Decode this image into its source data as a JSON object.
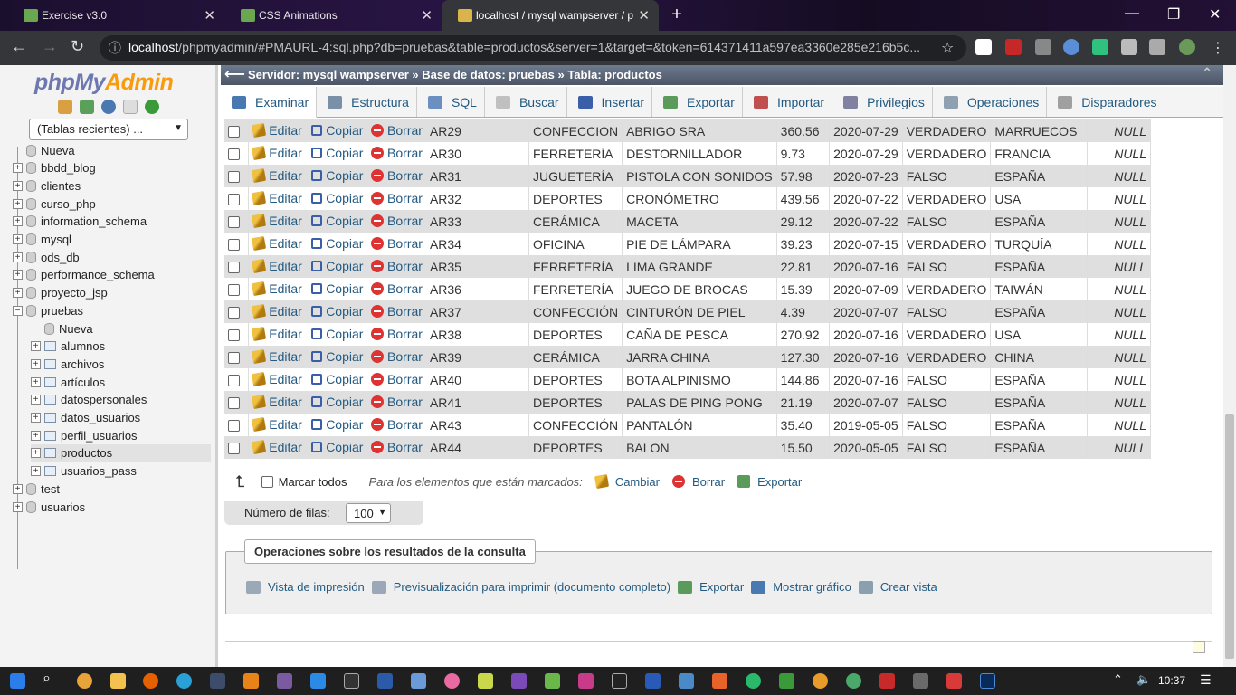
{
  "browser": {
    "tabs": [
      {
        "title": "Exercise v3.0",
        "active": false
      },
      {
        "title": "CSS Animations",
        "active": false
      },
      {
        "title": "localhost / mysql wampserver / p",
        "active": true
      }
    ],
    "url_host": "localhost",
    "url_rest": "/phpmyadmin/#PMAURL-4:sql.php?db=pruebas&table=productos&server=1&target=&token=614371411a597ea3360e285e216b5c..."
  },
  "sidebar": {
    "logo_php": "php",
    "logo_my": "My",
    "logo_admin": "Admin",
    "recent_select": "(Tablas recientes) ...",
    "tree": [
      {
        "label": "Nueva",
        "level": 0,
        "type": "new"
      },
      {
        "label": "bbdd_blog",
        "level": 0,
        "type": "db"
      },
      {
        "label": "clientes",
        "level": 0,
        "type": "db"
      },
      {
        "label": "curso_php",
        "level": 0,
        "type": "db"
      },
      {
        "label": "information_schema",
        "level": 0,
        "type": "db"
      },
      {
        "label": "mysql",
        "level": 0,
        "type": "db"
      },
      {
        "label": "ods_db",
        "level": 0,
        "type": "db"
      },
      {
        "label": "performance_schema",
        "level": 0,
        "type": "db"
      },
      {
        "label": "proyecto_jsp",
        "level": 0,
        "type": "db"
      },
      {
        "label": "pruebas",
        "level": 0,
        "type": "db-open"
      },
      {
        "label": "Nueva",
        "level": 1,
        "type": "new"
      },
      {
        "label": "alumnos",
        "level": 1,
        "type": "tbl"
      },
      {
        "label": "archivos",
        "level": 1,
        "type": "tbl"
      },
      {
        "label": "artículos",
        "level": 1,
        "type": "tbl"
      },
      {
        "label": "datospersonales",
        "level": 1,
        "type": "tbl"
      },
      {
        "label": "datos_usuarios",
        "level": 1,
        "type": "tbl"
      },
      {
        "label": "perfil_usuarios",
        "level": 1,
        "type": "tbl"
      },
      {
        "label": "productos",
        "level": 1,
        "type": "tbl",
        "selected": true
      },
      {
        "label": "usuarios_pass",
        "level": 1,
        "type": "tbl"
      },
      {
        "label": "test",
        "level": 0,
        "type": "db"
      },
      {
        "label": "usuarios",
        "level": 0,
        "type": "db"
      }
    ]
  },
  "breadcrumb": {
    "server": "Servidor: mysql wampserver »",
    "database": "Base de datos: pruebas »",
    "table": "Tabla: productos"
  },
  "tabs": [
    {
      "label": "Examinar",
      "active": true,
      "color": "#4a78b0"
    },
    {
      "label": "Estructura",
      "active": false,
      "color": "#7a8fa8"
    },
    {
      "label": "SQL",
      "active": false,
      "color": "#6a8fc0"
    },
    {
      "label": "Buscar",
      "active": false,
      "color": "#c0c0c0"
    },
    {
      "label": "Insertar",
      "active": false,
      "color": "#3a5fa8"
    },
    {
      "label": "Exportar",
      "active": false,
      "color": "#5a9a5a"
    },
    {
      "label": "Importar",
      "active": false,
      "color": "#c05050"
    },
    {
      "label": "Privilegios",
      "active": false,
      "color": "#8080a0"
    },
    {
      "label": "Operaciones",
      "active": false,
      "color": "#8fa0b0"
    },
    {
      "label": "Disparadores",
      "active": false,
      "color": "#a0a0a0"
    }
  ],
  "row_actions": {
    "edit": "Editar",
    "copy": "Copiar",
    "delete": "Borrar"
  },
  "rows": [
    [
      "AR29",
      "CONFECCION",
      "ABRIGO SRA",
      "360.56",
      "2020-07-29",
      "VERDADERO",
      "MARRUECOS",
      "NULL"
    ],
    [
      "AR30",
      "FERRETERÍA",
      "DESTORNILLADOR",
      "9.73",
      "2020-07-29",
      "VERDADERO",
      "FRANCIA",
      "NULL"
    ],
    [
      "AR31",
      "JUGUETERÍA",
      "PISTOLA CON SONIDOS",
      "57.98",
      "2020-07-23",
      "FALSO",
      "ESPAÑA",
      "NULL"
    ],
    [
      "AR32",
      "DEPORTES",
      "CRONÓMETRO",
      "439.56",
      "2020-07-22",
      "VERDADERO",
      "USA",
      "NULL"
    ],
    [
      "AR33",
      "CERÁMICA",
      "MACETA",
      "29.12",
      "2020-07-22",
      "FALSO",
      "ESPAÑA",
      "NULL"
    ],
    [
      "AR34",
      "OFICINA",
      "PIE DE LÁMPARA",
      "39.23",
      "2020-07-15",
      "VERDADERO",
      "TURQUÍA",
      "NULL"
    ],
    [
      "AR35",
      "FERRETERÍA",
      "LIMA GRANDE",
      "22.81",
      "2020-07-16",
      "FALSO",
      "ESPAÑA",
      "NULL"
    ],
    [
      "AR36",
      "FERRETERÍA",
      "JUEGO DE BROCAS",
      "15.39",
      "2020-07-09",
      "VERDADERO",
      "TAIWÁN",
      "NULL"
    ],
    [
      "AR37",
      "CONFECCIÓN",
      "CINTURÓN DE PIEL",
      "4.39",
      "2020-07-07",
      "FALSO",
      "ESPAÑA",
      "NULL"
    ],
    [
      "AR38",
      "DEPORTES",
      "CAÑA DE PESCA",
      "270.92",
      "2020-07-16",
      "VERDADERO",
      "USA",
      "NULL"
    ],
    [
      "AR39",
      "CERÁMICA",
      "JARRA CHINA",
      "127.30",
      "2020-07-16",
      "VERDADERO",
      "CHINA",
      "NULL"
    ],
    [
      "AR40",
      "DEPORTES",
      "BOTA ALPINISMO",
      "144.86",
      "2020-07-16",
      "FALSO",
      "ESPAÑA",
      "NULL"
    ],
    [
      "AR41",
      "DEPORTES",
      "PALAS DE PING PONG",
      "21.19",
      "2020-07-07",
      "FALSO",
      "ESPAÑA",
      "NULL"
    ],
    [
      "AR43",
      "CONFECCIÓN",
      "PANTALÓN",
      "35.40",
      "2019-05-05",
      "FALSO",
      "ESPAÑA",
      "NULL"
    ],
    [
      "AR44",
      "DEPORTES",
      "BALON",
      "15.50",
      "2020-05-05",
      "FALSO",
      "ESPAÑA",
      "NULL"
    ]
  ],
  "bulk": {
    "check_all": "Marcar todos",
    "with_selected": "Para los elementos que están marcados:",
    "change": "Cambiar",
    "delete": "Borrar",
    "export": "Exportar"
  },
  "rows_per_page": {
    "label": "Número de filas:",
    "value": "100"
  },
  "query_ops": {
    "legend": "Operaciones sobre los resultados de la consulta",
    "links": [
      "Vista de impresión",
      "Previsualización para imprimir (documento completo)",
      "Exportar",
      "Mostrar gráfico",
      "Crear vista"
    ]
  },
  "clock": "10:37"
}
